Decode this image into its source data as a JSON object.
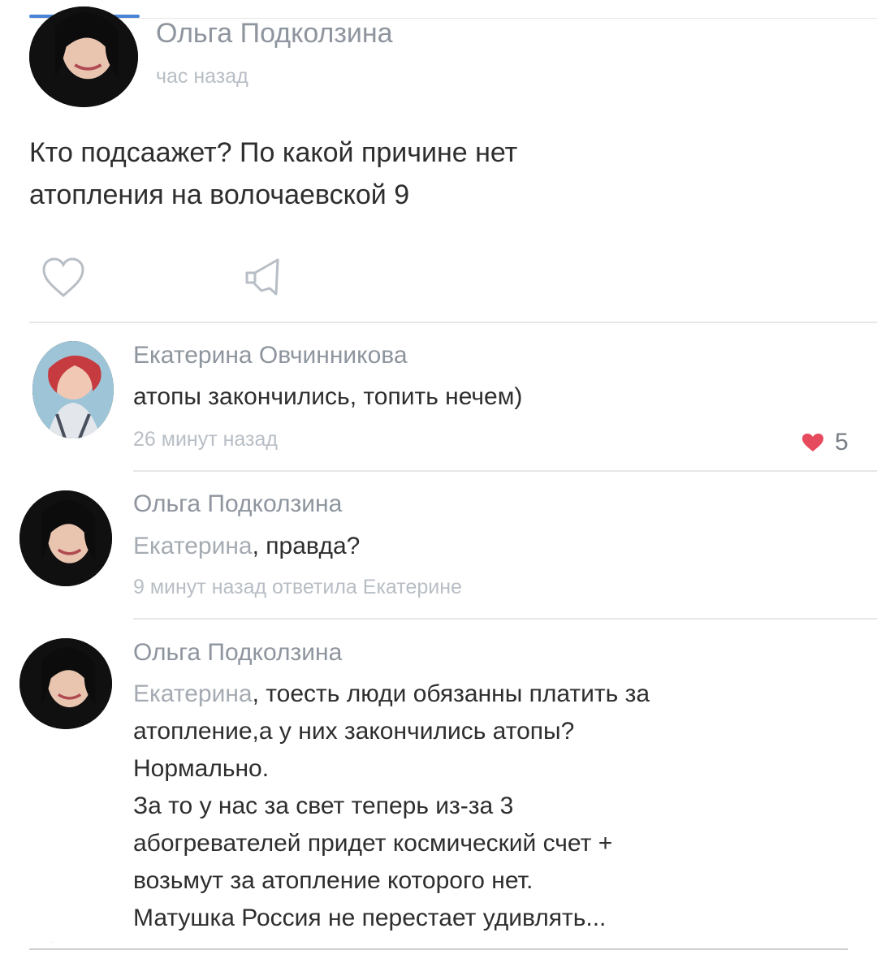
{
  "post": {
    "author": "Ольга Подколзина",
    "time": "час назад",
    "text_lines": [
      "Кто подсаажет? По какой причине нет",
      "атопления на волочаевской 9"
    ]
  },
  "comments": [
    {
      "author": "Екатерина Овчинникова",
      "text": "атопы закончились, топить нечем)",
      "time": "26 минут назад",
      "likes": "5"
    },
    {
      "author": "Ольга Подколзина",
      "mention": "Екатерина",
      "text": ", правда?",
      "time": "9 минут назад ответила Екатерине"
    },
    {
      "author": "Ольга Подколзина",
      "mention": "Екатерина",
      "first_line_rest": ", тоесть люди обязанны платить за",
      "text_lines": [
        "атопление,а у них закончились атопы?",
        "Нормально.",
        "За то у нас за свет теперь из-за 3",
        "абогревателей придет космический счет +",
        "возьмут за атопление которого нет.",
        "Матушка Россия не перестает удивлять..."
      ]
    }
  ],
  "colors": {
    "name": "#8e959e",
    "meta": "#b8bec5",
    "text": "#2e2e2e",
    "like_heart": "#e64a5d",
    "accent": "#4a84d6"
  },
  "icons": {
    "like": "heart-outline-icon",
    "share": "megaphone-icon",
    "liked": "heart-filled-icon"
  }
}
